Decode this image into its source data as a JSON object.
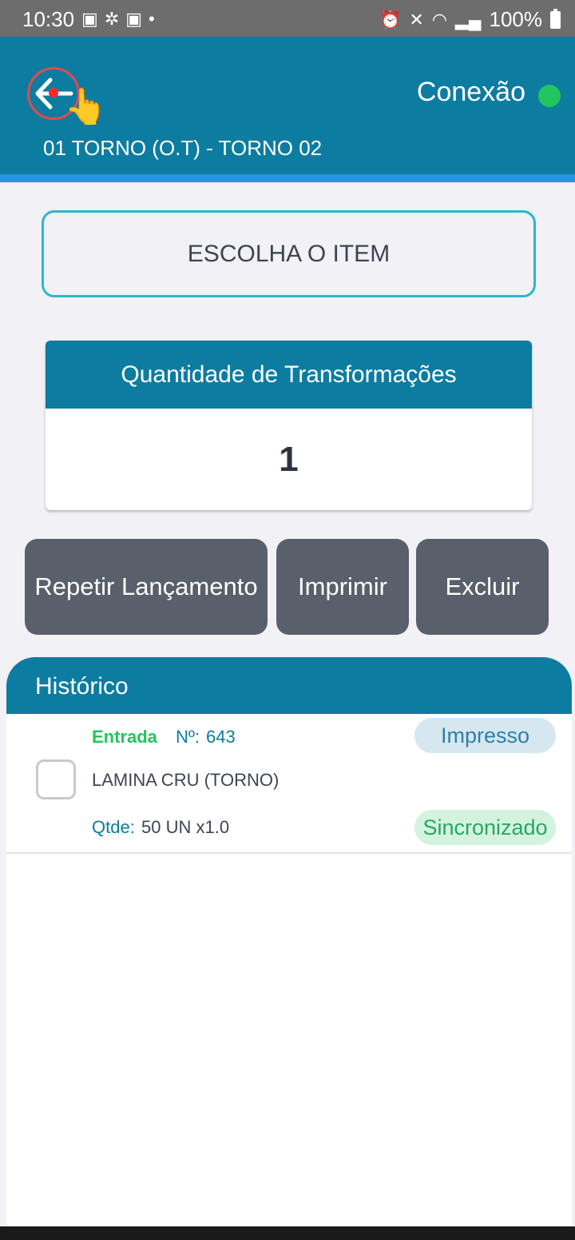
{
  "status_bar": {
    "time": "10:30",
    "battery": "100%"
  },
  "header": {
    "connection_label": "Conexão",
    "connection_color": "#22c55e",
    "machine_title": "01 TORNO (O.T) - TORNO 02"
  },
  "choose_item": {
    "label": "ESCOLHA O ITEM"
  },
  "quantity": {
    "title": "Quantidade de Transformações",
    "value": "1"
  },
  "actions": {
    "repeat": "Repetir Lançamento",
    "print": "Imprimir",
    "delete": "Excluir"
  },
  "history": {
    "title": "Histórico",
    "entries": [
      {
        "type": "Entrada",
        "number_label": "Nº:",
        "number": "643",
        "item": "LAMINA CRU (TORNO)",
        "qty_label": "Qtde:",
        "qty": "50 UN x1.0",
        "badge_printed": "Impresso",
        "badge_sync": "Sincronizado"
      }
    ]
  },
  "colors": {
    "primary": "#0d7ca1",
    "accent_border": "#2bb7cc",
    "button": "#595f6b"
  }
}
